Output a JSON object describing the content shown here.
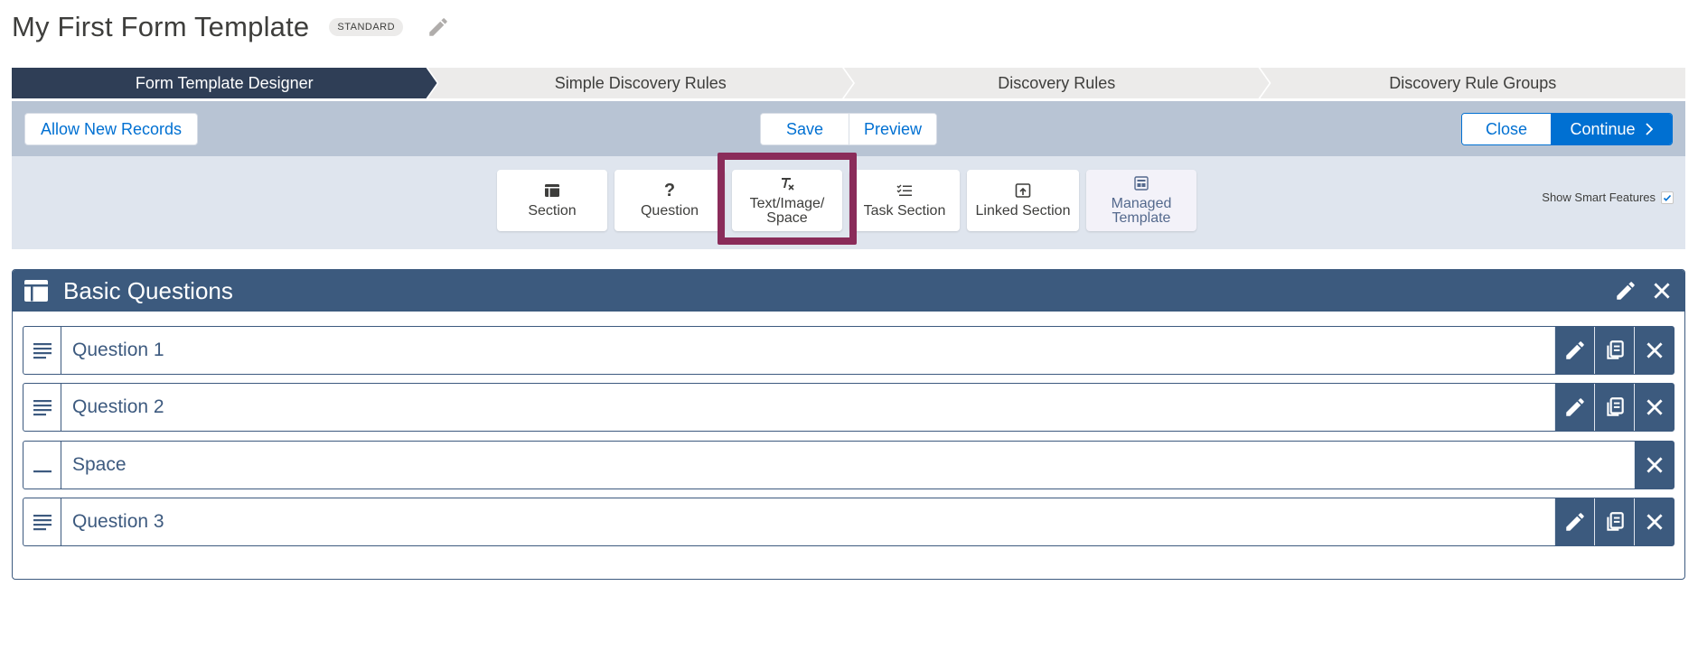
{
  "header": {
    "title": "My First Form Template",
    "badge": "STANDARD",
    "edit_icon": "pencil-icon"
  },
  "path": {
    "steps": [
      {
        "label": "Form Template Designer",
        "active": true
      },
      {
        "label": "Simple Discovery Rules",
        "active": false
      },
      {
        "label": "Discovery Rules",
        "active": false
      },
      {
        "label": "Discovery Rule Groups",
        "active": false
      }
    ]
  },
  "toolbar": {
    "allow_new_records": "Allow New Records",
    "save": "Save",
    "preview": "Preview",
    "close": "Close",
    "continue": "Continue"
  },
  "palette": {
    "items": [
      {
        "label": "Section",
        "icon": "section-icon"
      },
      {
        "label": "Question",
        "icon": "question-mark-icon"
      },
      {
        "label": "Text/Image/\nSpace",
        "icon": "clear-formatting-icon"
      },
      {
        "label": "Task Section",
        "icon": "checklist-icon"
      },
      {
        "label": "Linked Section",
        "icon": "linked-upload-icon"
      },
      {
        "label": "Managed\nTemplate",
        "icon": "template-icon"
      }
    ],
    "highlighted": "Text/Image/\nSpace",
    "highlight_color": "#8a2c5a",
    "show_smart_features": "Show Smart Features",
    "show_smart_features_checked": true
  },
  "section": {
    "title": "Basic Questions",
    "header_color": "#3c5a7e",
    "rows": [
      {
        "label": "Question 1",
        "type": "text-lines-icon",
        "actions": [
          "edit",
          "copy",
          "delete"
        ]
      },
      {
        "label": "Question 2",
        "type": "text-lines-icon",
        "actions": [
          "edit",
          "copy",
          "delete"
        ]
      },
      {
        "label": "Space",
        "type": "underscore-icon",
        "actions": [
          "delete"
        ]
      },
      {
        "label": "Question 3",
        "type": "text-lines-icon",
        "actions": [
          "edit",
          "copy",
          "delete"
        ]
      }
    ]
  },
  "colors": {
    "accent": "#0070d2",
    "path_active": "#2f3e56",
    "toolbar_bg": "#b8c4d4",
    "palette_bg": "#dfe5ee"
  }
}
